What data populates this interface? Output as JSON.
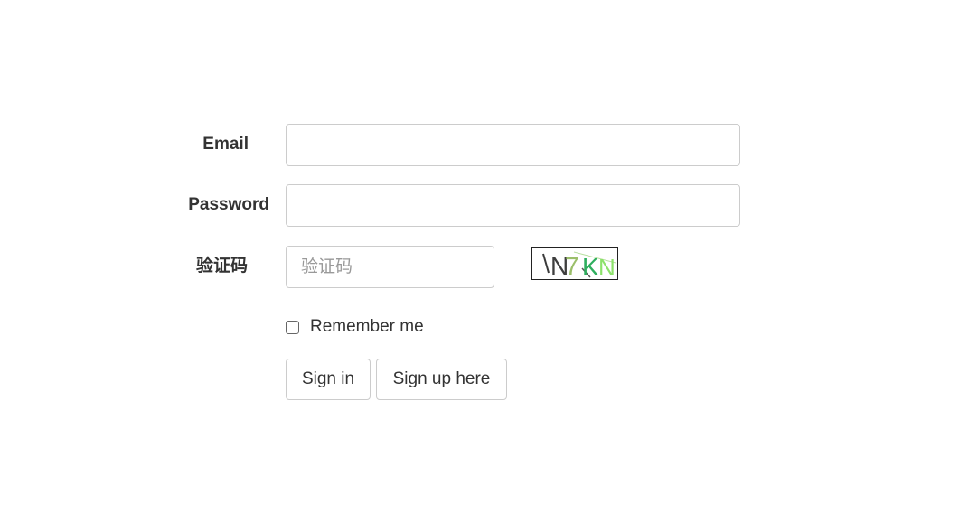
{
  "form": {
    "email": {
      "label": "Email",
      "value": "",
      "placeholder": ""
    },
    "password": {
      "label": "Password",
      "value": "",
      "placeholder": ""
    },
    "captcha": {
      "label": "验证码",
      "value": "",
      "placeholder": "验证码",
      "image_text": "N7KN"
    },
    "remember": {
      "label": "Remember me",
      "checked": false
    },
    "buttons": {
      "sign_in": "Sign in",
      "sign_up": "Sign up here"
    }
  }
}
